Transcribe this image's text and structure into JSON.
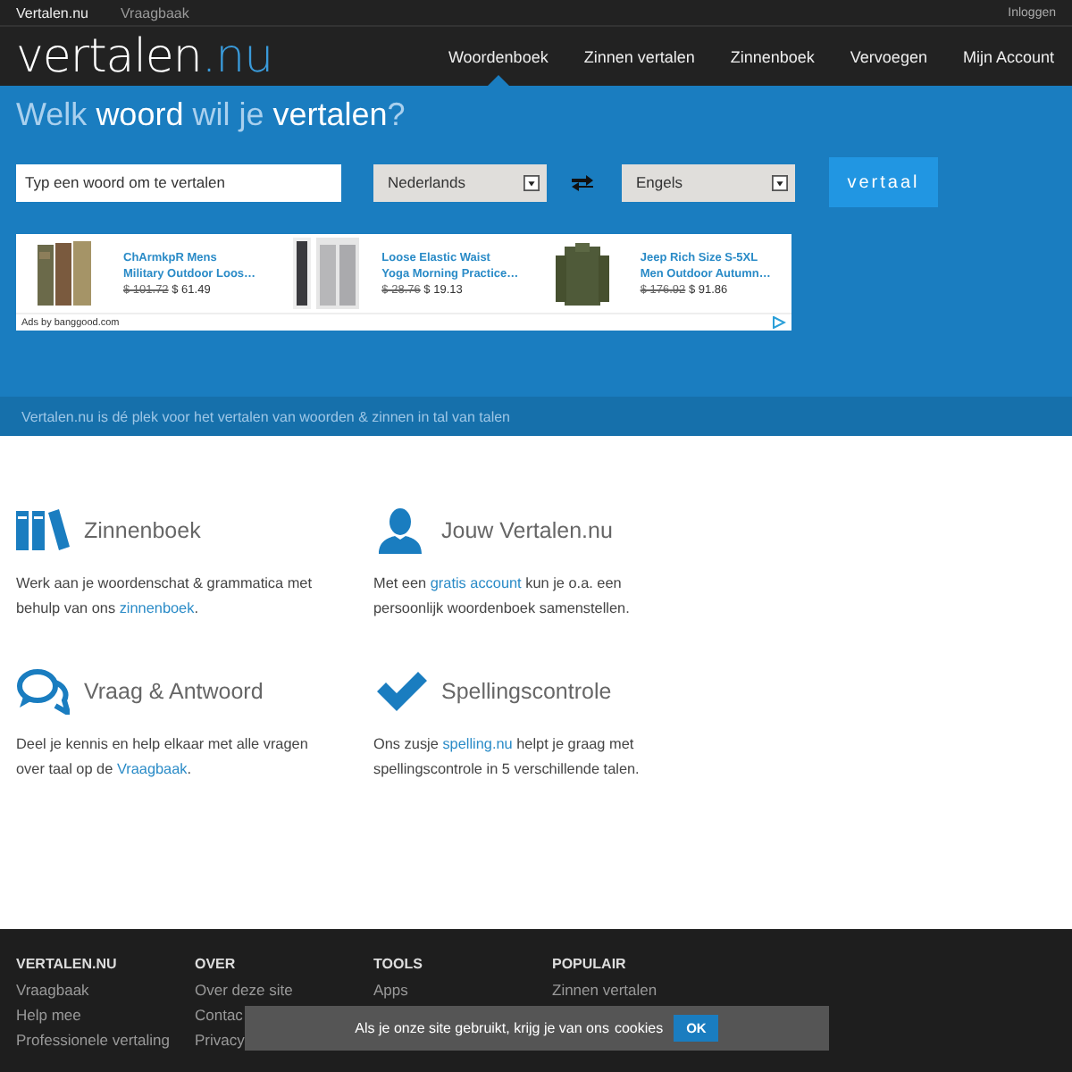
{
  "top_links": [
    {
      "label": "Vertalen.nu",
      "selected": true
    },
    {
      "label": "Vraagbaak",
      "selected": false
    }
  ],
  "login": "Inloggen",
  "logo": {
    "main": "vertalen",
    "suffix": ".nu"
  },
  "nav": [
    {
      "label": "Woordenboek",
      "selected": true
    },
    {
      "label": "Zinnen vertalen",
      "selected": false
    },
    {
      "label": "Zinnenboek",
      "selected": false
    },
    {
      "label": "Vervoegen",
      "selected": false
    },
    {
      "label": "Mijn Account",
      "selected": false
    }
  ],
  "hero": {
    "heading": "Welk **woord** wil je **vertalen**?",
    "search": {
      "placeholder": "Typ een woord om te vertalen"
    },
    "source_language": "Nederlands",
    "target_language": "Engels",
    "button": "vertaal"
  },
  "ads": {
    "items": [
      {
        "title_lines": [
          "ChArmkpR Mens",
          "Military Outdoor Loos…"
        ],
        "old_price": "$ 101.72",
        "price": "$ 61.49"
      },
      {
        "title_lines": [
          "Loose Elastic Waist",
          "Yoga Morning Practice…"
        ],
        "old_price": "$ 28.76",
        "price": "$ 19.13"
      },
      {
        "title_lines": [
          "Jeep Rich Size S-5XL",
          "Men Outdoor Autumn…"
        ],
        "old_price": "$ 176.92",
        "price": "$ 91.86"
      }
    ],
    "footer": "Ads by banggood.com"
  },
  "tagline": "Vertalen.nu is dé plek voor het vertalen van woorden & zinnen in tal van talen",
  "features": [
    {
      "kind": "books",
      "title": "Zinnenboek",
      "before": "Werk aan je woordenschat & grammatica met behulp van ons ",
      "link": "zinnenboek",
      "after": "."
    },
    {
      "kind": "person",
      "title": "Jouw Vertalen.nu",
      "before": "Met een ",
      "link": "gratis account",
      "after": " kun je o.a. een persoonlijk woordenboek samenstellen."
    },
    {
      "kind": "chat",
      "title": "Vraag & Antwoord",
      "before": "Deel je kennis en help elkaar met alle vragen over taal op de ",
      "link": "Vraagbaak",
      "after": "."
    },
    {
      "kind": "check",
      "title": "Spellingscontrole",
      "before": "Ons zusje ",
      "link": "spelling.nu",
      "after": " helpt je graag met spellingscontrole in 5 verschillende talen."
    }
  ],
  "footer": {
    "columns": [
      {
        "heading": "VERTALEN.NU",
        "links": [
          "Vraagbaak",
          "Help mee",
          "Professionele vertaling"
        ]
      },
      {
        "heading": "OVER",
        "links": [
          "Over deze site",
          "Contac",
          "Privacy"
        ]
      },
      {
        "heading": "TOOLS",
        "links": [
          "Apps"
        ]
      },
      {
        "heading": "POPULAIR",
        "links": [
          "Zinnen vertalen"
        ]
      }
    ]
  },
  "cookie_bar": {
    "text": "Als je onze site gebruikt, krijg je van ons",
    "link": "cookies",
    "button": "OK"
  }
}
